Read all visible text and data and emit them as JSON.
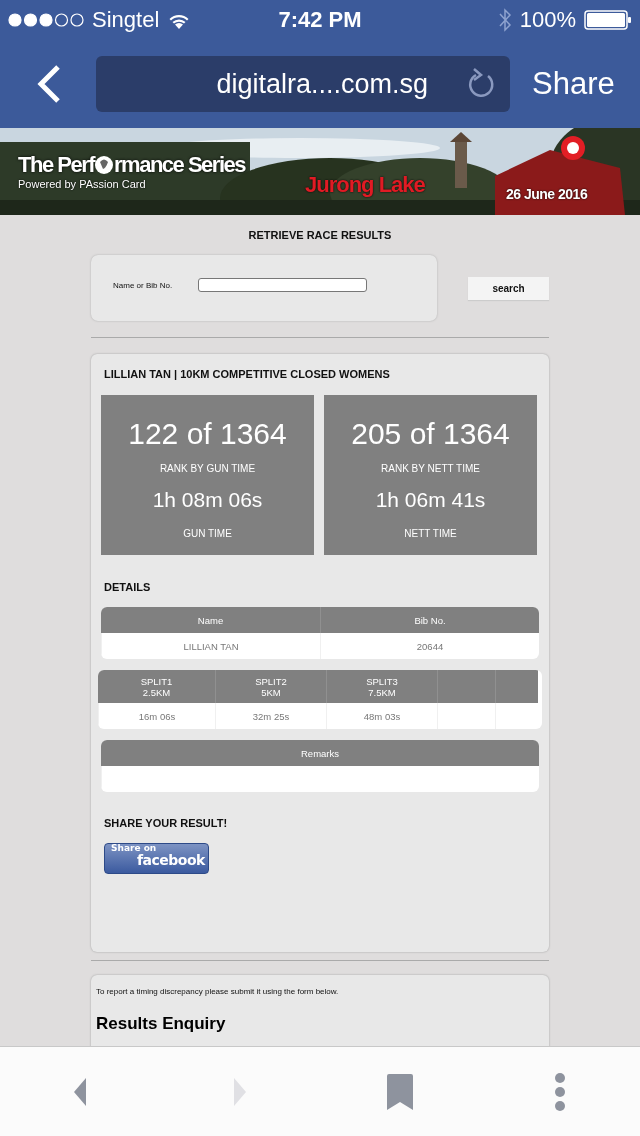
{
  "status_bar": {
    "carrier": "Singtel",
    "time": "7:42 PM",
    "battery": "100%"
  },
  "nav": {
    "url": "digitalra....com.sg",
    "share": "Share"
  },
  "banner": {
    "kind": "picture",
    "logo_start": "The Perf",
    "logo_end": "rmance Series",
    "tagline": "Powered by PAssion Card",
    "location": "Jurong Lake",
    "date": "26 June 2016"
  },
  "search": {
    "title": "RETRIEVE RACE RESULTS",
    "label": "Name or Bib No.",
    "button": "search"
  },
  "result": {
    "heading": "LILLIAN TAN | 10KM COMPETITIVE CLOSED WOMENS",
    "stats": [
      {
        "rank": "122 of 1364",
        "rank_label": "RANK BY GUN TIME",
        "time": "1h 08m 06s",
        "time_label": "GUN TIME"
      },
      {
        "rank": "205 of 1364",
        "rank_label": "RANK BY NETT TIME",
        "time": "1h 06m 41s",
        "time_label": "NETT TIME"
      }
    ],
    "details_title": "DETAILS",
    "details": {
      "columns": [
        "Name",
        "Bib No."
      ],
      "row": [
        "LILLIAN TAN",
        "20644"
      ]
    },
    "splits": [
      {
        "kind": "split",
        "title": "SPLIT1",
        "distance": "2.5KM",
        "time": "16m 06s"
      },
      {
        "kind": "split",
        "title": "SPLIT2",
        "distance": "5KM",
        "time": "32m 25s"
      },
      {
        "kind": "split",
        "title": "SPLIT3",
        "distance": "7.5KM",
        "time": "48m 03s"
      },
      {
        "kind": "empty"
      },
      {
        "kind": "empty"
      }
    ],
    "remarks": {
      "column": "Remarks"
    },
    "share_title": "SHARE YOUR RESULT!",
    "share_button": {
      "small": "Share on",
      "big": "facebook"
    }
  },
  "enquiry": {
    "note": "To report a timing discrepancy please submit it using the form below.",
    "title": "Results Enquiry"
  },
  "toolbar": [
    {
      "kind": "back",
      "disabled": false
    },
    {
      "kind": "forward",
      "disabled": true
    },
    {
      "kind": "bookmarks",
      "disabled": false
    },
    {
      "kind": "more",
      "disabled": false
    }
  ]
}
